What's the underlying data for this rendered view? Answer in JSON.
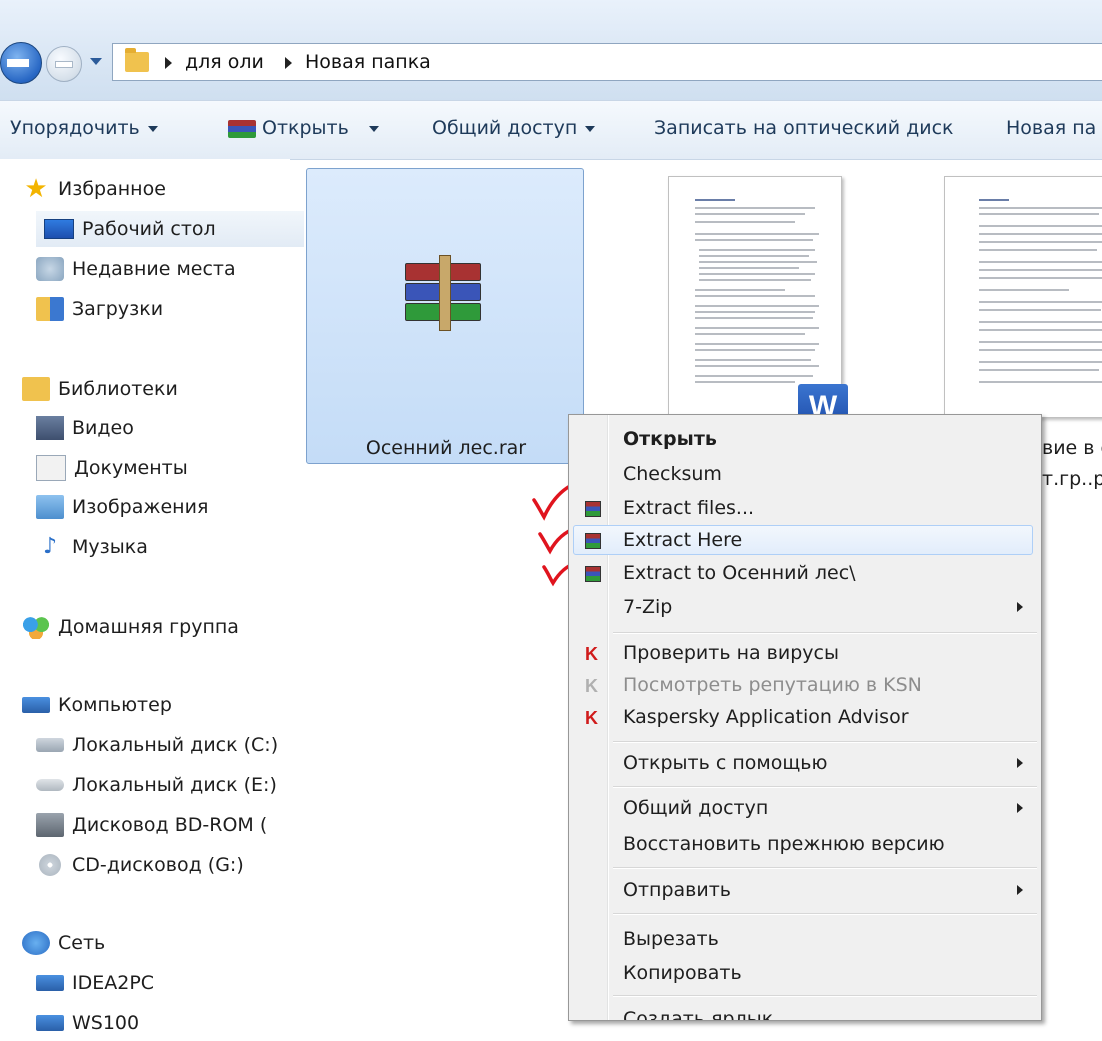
{
  "address": {
    "crumbs": [
      "для оли",
      "Новая папка"
    ]
  },
  "toolbar": {
    "organize": "Упорядочить",
    "open": "Открыть",
    "share": "Общий доступ",
    "burn": "Записать на оптический диск",
    "new_folder": "Новая па"
  },
  "sidebar": {
    "favorites": "Избранное",
    "desktop": "Рабочий стол",
    "recent": "Недавние места",
    "downloads": "Загрузки",
    "libraries": "Библиотеки",
    "video": "Видео",
    "documents": "Документы",
    "images": "Изображения",
    "music": "Музыка",
    "homegroup": "Домашняя группа",
    "computer": "Компьютер",
    "drive_c": "Локальный диск (C:)",
    "drive_e": "Локальный диск (E:)",
    "drive_bd": "Дисковод BD-ROM (",
    "drive_cd": "CD-дисковод (G:)",
    "network": "Сеть",
    "pc1": "IDEA2PC",
    "pc2": "WS100"
  },
  "files": {
    "rar_name": "Осенний лес.rar",
    "pdf_name_line1": "вие в с",
    "pdf_name_line2": "т.гр..pd"
  },
  "menu": {
    "open": "Открыть",
    "checksum": "Checksum",
    "extract_files": "Extract files...",
    "extract_here": "Extract Here",
    "extract_to": "Extract to Осенний лес\\",
    "seven_zip": "7-Zip",
    "scan": "Проверить на вирусы",
    "reputation": "Посмотреть репутацию в KSN",
    "advisor": "Kaspersky Application Advisor",
    "open_with": "Открыть с помощью",
    "share": "Общий доступ",
    "restore": "Восстановить прежнюю версию",
    "send_to": "Отправить",
    "cut": "Вырезать",
    "copy": "Копировать",
    "shortcut": "Создать ярлык"
  },
  "colors": {
    "annotation_check": "#e0141e",
    "menu_highlight": "#e2edfb",
    "selection": "#c4dcf7"
  }
}
